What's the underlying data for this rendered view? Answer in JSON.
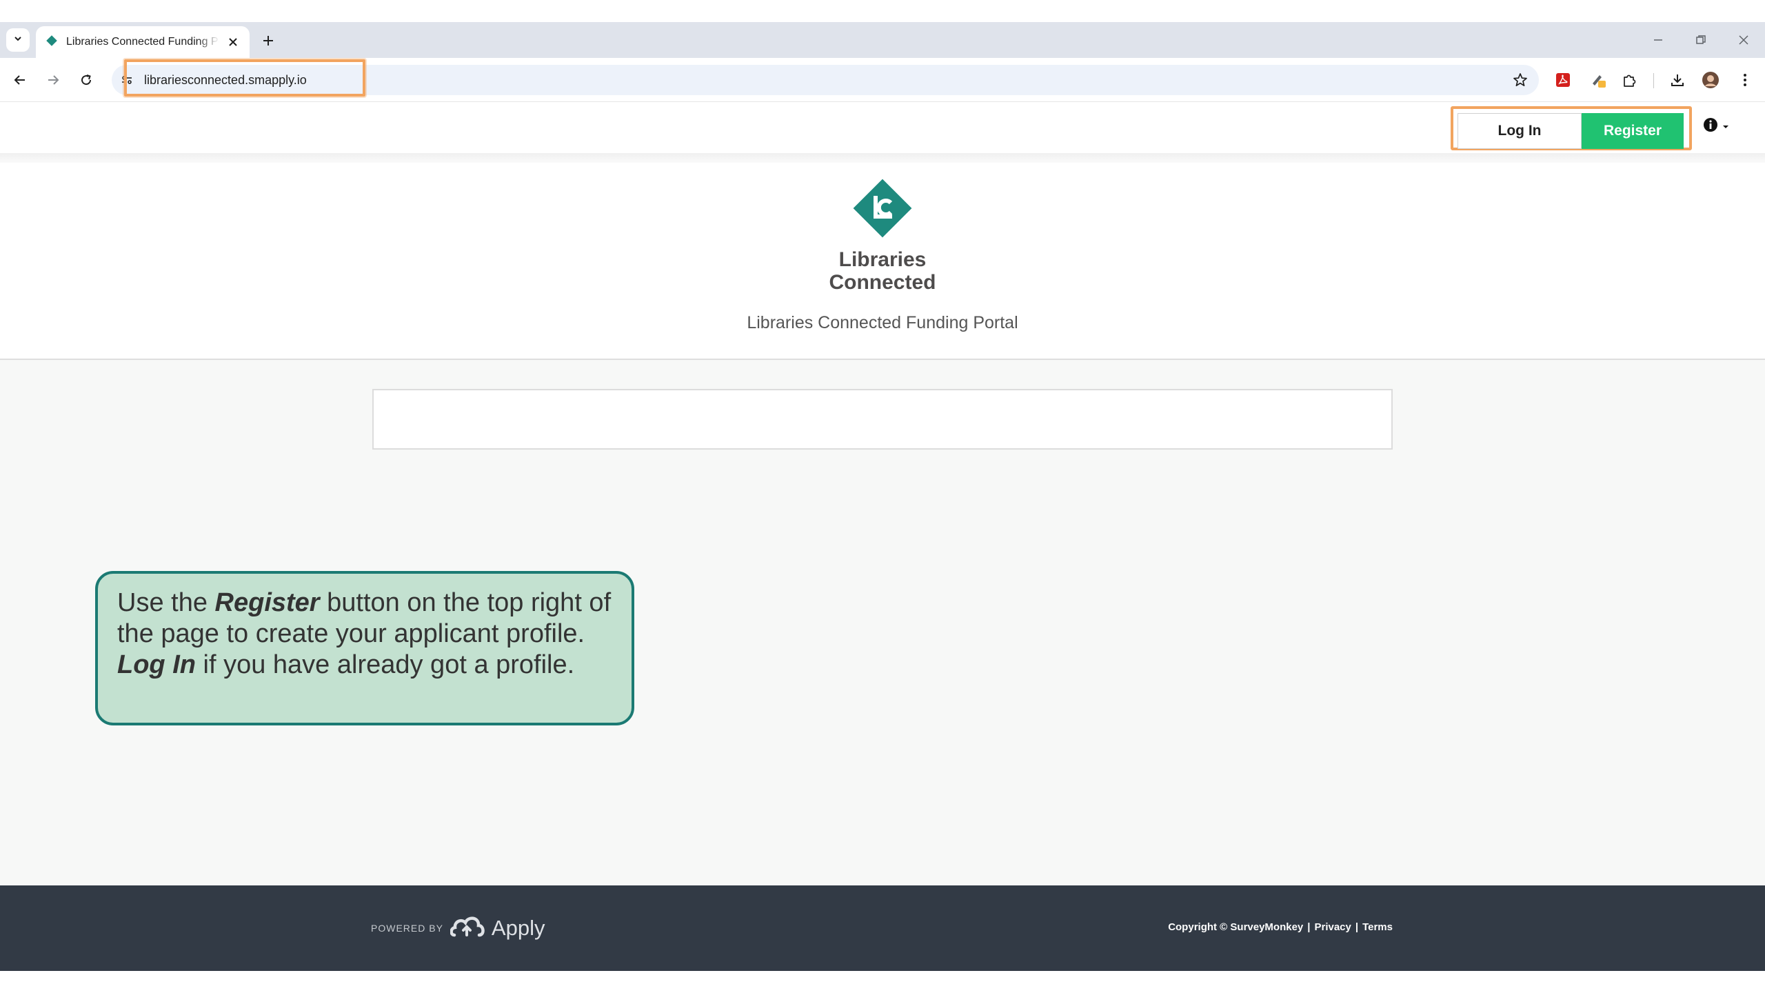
{
  "browser": {
    "tab_title": "Libraries Connected Funding Portal",
    "url": "librariesconnected.smapply.io"
  },
  "nav": {
    "login_label": "Log In",
    "register_label": "Register"
  },
  "header": {
    "logo_line1": "Libraries",
    "logo_line2": "Connected",
    "portal_name": "Libraries Connected Funding Portal"
  },
  "callout": {
    "text_1": "Use the ",
    "bold_1": "Register",
    "text_2": " button on the top right of the page to create your applicant profile. ",
    "bold_2": "Log In",
    "text_3": " if you have already got a profile."
  },
  "footer": {
    "powered_by": "POWERED BY",
    "brand": "Apply",
    "copyright": "Copyright © SurveyMonkey",
    "privacy": "Privacy",
    "terms": "Terms",
    "separator": "|"
  },
  "colors": {
    "brand_teal": "#1e8a7e",
    "register_green": "#20c271",
    "highlight_orange": "#f2a45f",
    "callout_fill": "#c3e1d0",
    "footer_bg": "#323a45"
  }
}
